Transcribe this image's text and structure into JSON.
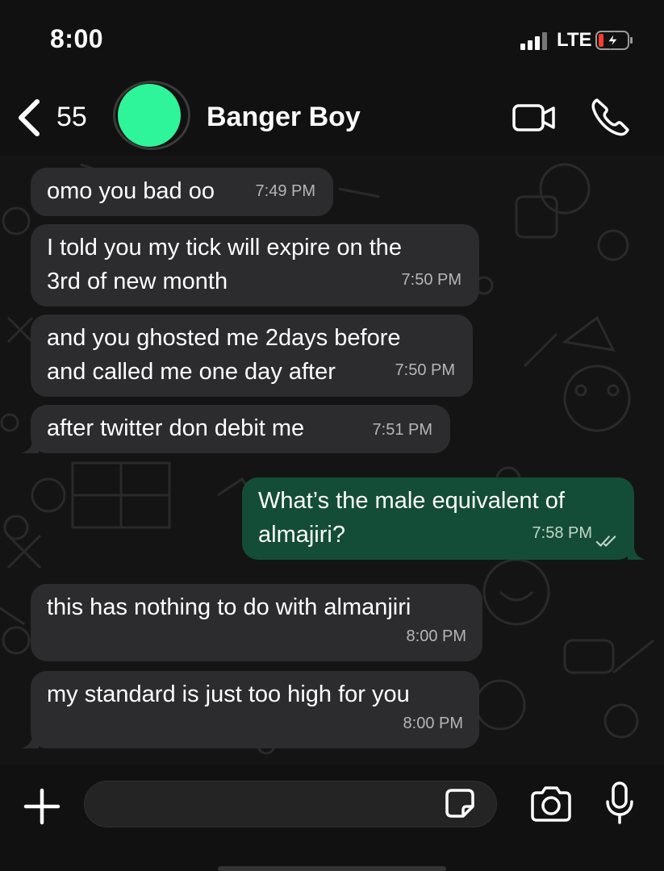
{
  "status_bar": {
    "time": "8:00",
    "network": "LTE",
    "signal_icon": "signal-bars-icon",
    "battery_icon": "battery-charging-icon",
    "battery_level_color": "#ff3b30"
  },
  "header": {
    "back_count": "55",
    "contact_name": "Banger Boy",
    "avatar_color": "#2ef59a",
    "icons": [
      "chevron-left-icon",
      "video-camera-icon",
      "phone-icon"
    ]
  },
  "messages": [
    {
      "direction": "incoming",
      "text": "omo you bad oo",
      "time": "7:49 PM"
    },
    {
      "direction": "incoming",
      "text": "I told you my tick will expire on the\n3rd of new month",
      "time": "7:50 PM"
    },
    {
      "direction": "incoming",
      "text": "and you ghosted me 2days before\nand called me one day after",
      "time": "7:50 PM"
    },
    {
      "direction": "incoming",
      "text": "after twitter don debit me",
      "time": "7:51 PM"
    },
    {
      "direction": "outgoing",
      "text": "What’s the male equivalent of\nalmajiri?",
      "time": "7:58 PM",
      "read_icon": "double-check-icon"
    },
    {
      "direction": "incoming",
      "text": "this has nothing to do with almanjiri",
      "time": "8:00 PM"
    },
    {
      "direction": "incoming",
      "text": "my standard is just too high for you",
      "time": "8:00 PM"
    }
  ],
  "composer": {
    "icons": [
      "plus-icon",
      "sticker-icon",
      "camera-icon",
      "microphone-icon"
    ],
    "input_value": ""
  },
  "colors": {
    "incoming_bubble": "#2c2c2e",
    "outgoing_bubble": "#144d37",
    "chat_background": "#141414"
  }
}
